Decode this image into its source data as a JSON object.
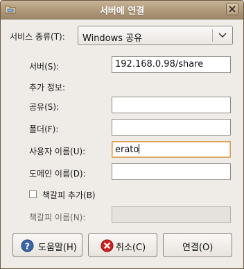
{
  "window": {
    "title": "서버에 연결"
  },
  "form": {
    "service_type_label": "서비스 종류(T):",
    "service_type_value": "Windows 공유",
    "server_label": "서버(S):",
    "server_value": "192.168.0.98/share",
    "extra_info_label": "추가 정보:",
    "share_label": "공유(S):",
    "share_value": "",
    "folder_label": "폴더(F):",
    "folder_value": "",
    "username_label": "사용자 이름(U):",
    "username_value": "erato",
    "domain_label": "도메인 이름(D):",
    "domain_value": "",
    "bookmark_check_label": "책갈피 추가(B)",
    "bookmark_checked": false,
    "bookmark_name_label": "책갈피 이름(N):",
    "bookmark_name_value": ""
  },
  "buttons": {
    "help_label": "도움말(H)",
    "cancel_label": "취소(C)",
    "connect_label": "연결(O)"
  },
  "icons": {
    "window_icon": "folder-network-icon",
    "close": "close-icon",
    "combo_arrow": "chevron-down-icon",
    "help": "help-icon",
    "cancel": "cancel-icon"
  },
  "colors": {
    "titlebar": "#b39d7f",
    "dialog_bg": "#efebe7",
    "focus_border": "#d7a15a",
    "help_icon": "#3a64a8",
    "cancel_icon": "#cc2222"
  }
}
